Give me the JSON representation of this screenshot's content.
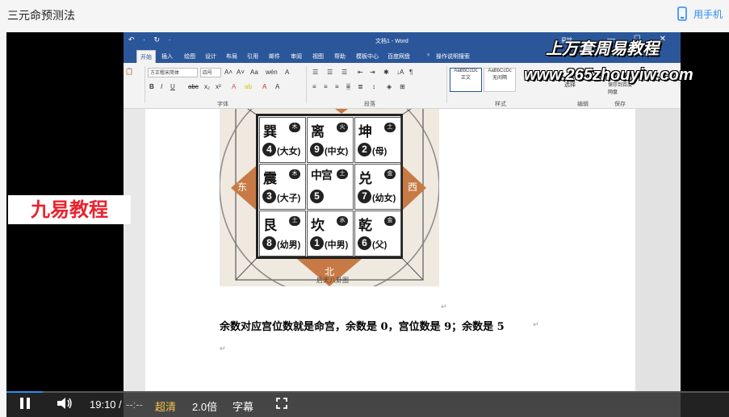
{
  "page": {
    "title": "三元命预测法",
    "mobile_link": "用手机"
  },
  "word": {
    "titlebar_doc": "文档1 - Word",
    "quick_access": "↶ · ↻ ·",
    "user": "易铭",
    "tabs": [
      "开始",
      "插入",
      "绘图",
      "设计",
      "布局",
      "引用",
      "邮件",
      "审阅",
      "视图",
      "帮助",
      "模板中心",
      "百度网盘",
      "操作说明搜索"
    ],
    "font_name": "方正粗宋简体",
    "font_size": "四号",
    "group_labels": {
      "font": "字体",
      "paragraph": "段落",
      "styles": "样式",
      "editing": "编辑",
      "save": "保存"
    },
    "style_names": [
      "AaBbCcDc",
      "AaBbCcDc",
      "AaBbC"
    ],
    "style_labels": [
      "正文",
      "无间隔",
      "标题 1"
    ],
    "edit_label": "选择",
    "save_label": "保存到百度网盘"
  },
  "figure": {
    "caption": "后天八卦图",
    "directions": {
      "east": "东",
      "west": "西",
      "north": "北"
    },
    "cells": [
      {
        "name": "巽",
        "element": "木",
        "number": "4",
        "relation": "(大女)"
      },
      {
        "name": "离",
        "element": "火",
        "number": "9",
        "relation": "(中女)"
      },
      {
        "name": "坤",
        "element": "土",
        "number": "2",
        "relation": "(母)"
      },
      {
        "name": "震",
        "element": "木",
        "number": "3",
        "relation": "(大子)"
      },
      {
        "name": "中宫",
        "element": "土",
        "number": "5",
        "relation": ""
      },
      {
        "name": "兑",
        "element": "金",
        "number": "7",
        "relation": "(幼女)"
      },
      {
        "name": "艮",
        "element": "土",
        "number": "8",
        "relation": "(幼男)"
      },
      {
        "name": "坎",
        "element": "水",
        "number": "1",
        "relation": "(中男)"
      },
      {
        "name": "乾",
        "element": "金",
        "number": "6",
        "relation": "(父)"
      }
    ]
  },
  "document": {
    "line1": "余数对应宫位数就是命宫，余数是 0，宫位数是 9；余数是 5"
  },
  "overlay": {
    "title": "上万套周易教程",
    "site": "www.265zhouyiw.com",
    "badge": "九易教程"
  },
  "player": {
    "time_current": "19:10",
    "time_sep": "/",
    "time_total": "--:--",
    "quality": "超清",
    "speed": "2.0倍",
    "subtitle": "字幕",
    "progress": 0.05,
    "colors": {
      "accent": "#2a8cf0",
      "hd": "#f5c34a",
      "word_blue": "#2b579a",
      "badge_red": "#e8232f"
    }
  }
}
